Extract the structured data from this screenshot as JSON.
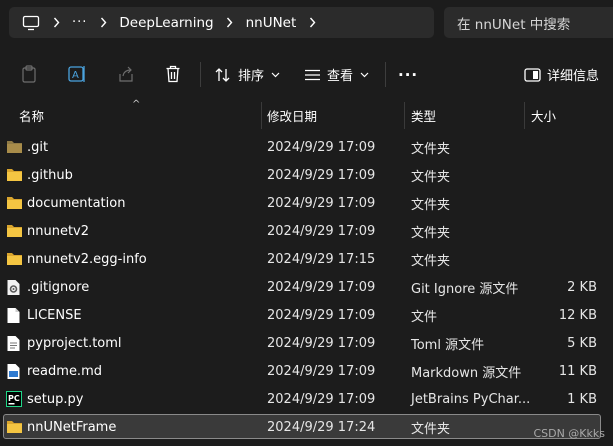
{
  "address_bar": {
    "overflow": "···",
    "crumbs": [
      "DeepLearning",
      "nnUNet"
    ]
  },
  "search": {
    "placeholder": "在 nnUNet 中搜索"
  },
  "toolbar": {
    "sort_label": "排序",
    "view_label": "查看",
    "more_label": "···",
    "details_label": "详细信息"
  },
  "columns": {
    "name": "名称",
    "date": "修改日期",
    "type": "类型",
    "size": "大小"
  },
  "files": [
    {
      "name": ".git",
      "date": "2024/9/29 17:09",
      "type": "文件夹",
      "size": "",
      "icon": "folder-icon"
    },
    {
      "name": ".github",
      "date": "2024/9/29 17:09",
      "type": "文件夹",
      "size": "",
      "icon": "folder-icon"
    },
    {
      "name": "documentation",
      "date": "2024/9/29 17:09",
      "type": "文件夹",
      "size": "",
      "icon": "folder-icon"
    },
    {
      "name": "nnunetv2",
      "date": "2024/9/29 17:09",
      "type": "文件夹",
      "size": "",
      "icon": "folder-icon"
    },
    {
      "name": "nnunetv2.egg-info",
      "date": "2024/9/29 17:15",
      "type": "文件夹",
      "size": "",
      "icon": "folder-icon"
    },
    {
      "name": ".gitignore",
      "date": "2024/9/29 17:09",
      "type": "Git Ignore 源文件",
      "size": "2 KB",
      "icon": "gear-file-icon"
    },
    {
      "name": "LICENSE",
      "date": "2024/9/29 17:09",
      "type": "文件",
      "size": "12 KB",
      "icon": "blank-file-icon"
    },
    {
      "name": "pyproject.toml",
      "date": "2024/9/29 17:09",
      "type": "Toml 源文件",
      "size": "5 KB",
      "icon": "text-file-icon"
    },
    {
      "name": "readme.md",
      "date": "2024/9/29 17:09",
      "type": "Markdown 源文件",
      "size": "11 KB",
      "icon": "markdown-file-icon"
    },
    {
      "name": "setup.py",
      "date": "2024/9/29 17:09",
      "type": "JetBrains PyChar...",
      "size": "1 KB",
      "icon": "pycharm-file-icon"
    },
    {
      "name": "nnUNetFrame",
      "date": "2024/9/29 17:24",
      "type": "文件夹",
      "size": "",
      "icon": "folder-icon",
      "selected": true
    }
  ],
  "watermark": "CSDN @Kkks",
  "colors": {
    "background": "#1c1c1c",
    "folder": "#e8b73c",
    "selection": "#3a3a3a",
    "pycharm_green": "#21d789"
  }
}
